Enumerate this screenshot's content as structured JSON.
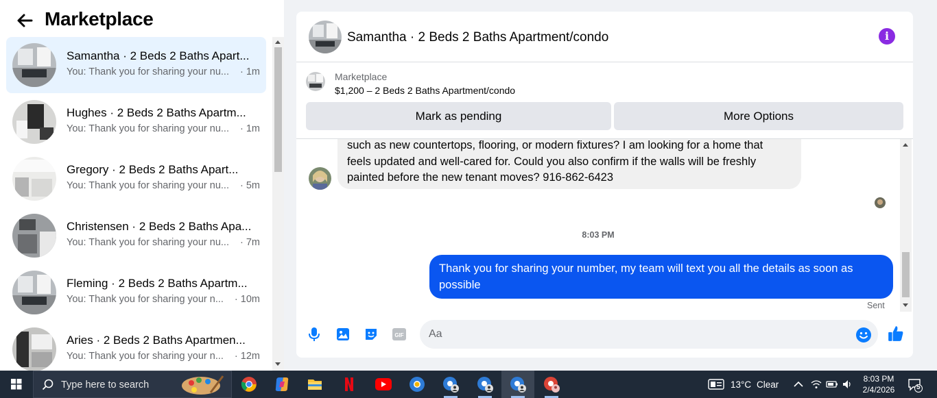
{
  "sidebar": {
    "title": "Marketplace",
    "conversations": [
      {
        "name": "Samantha · 2 Beds 2 Baths Apart...",
        "preview": "You: Thank you for sharing your nu...",
        "time": " · 1m"
      },
      {
        "name": "Hughes · 2 Beds 2 Baths Apartm...",
        "preview": "You: Thank you for sharing your nu...",
        "time": " · 1m"
      },
      {
        "name": "Gregory · 2 Beds 2 Baths Apart...",
        "preview": "You: Thank you for sharing your nu...",
        "time": " · 5m"
      },
      {
        "name": "Christensen · 2 Beds 2 Baths Apa...",
        "preview": "You: Thank you for sharing your nu...",
        "time": " · 7m"
      },
      {
        "name": "Fleming · 2 Beds 2 Baths Apartm...",
        "preview": "You: Thank you for sharing your n...",
        "time": " · 10m"
      },
      {
        "name": "Aries · 2 Beds 2 Baths Apartmen...",
        "preview": "You: Thank you for sharing your n...",
        "time": " · 12m"
      }
    ]
  },
  "chat": {
    "title": "Samantha · 2 Beds 2 Baths Apartment/condo",
    "listing": {
      "source": "Marketplace",
      "title": "$1,200 – 2 Beds 2 Baths Apartment/condo",
      "mark_pending": "Mark as pending",
      "more_options": "More Options"
    },
    "incoming_lines": [
      "such as new countertops, flooring, or modern fixtures? I am looking for a home that",
      "feels updated and well-cared for. Could you also confirm if the walls will be freshly",
      "painted before the new tenant moves? 916-862-6423"
    ],
    "timestamp": "8:03 PM",
    "outgoing": "Thank you for  sharing your number, my team will text you all the details as soon as possible",
    "sent_status": "Sent",
    "composer_placeholder": "Aa"
  },
  "taskbar": {
    "search_placeholder": "Type here to search",
    "weather_temp": "13°C",
    "weather_desc": "Clear",
    "time": "8:03 PM",
    "date": "2/4/2026",
    "notification_count": "5"
  },
  "colors": {
    "accent": "#0a7cff",
    "outgoing_bubble": "#0a56f0",
    "info": "#8a2be2",
    "taskbar": "#1f2a38"
  }
}
